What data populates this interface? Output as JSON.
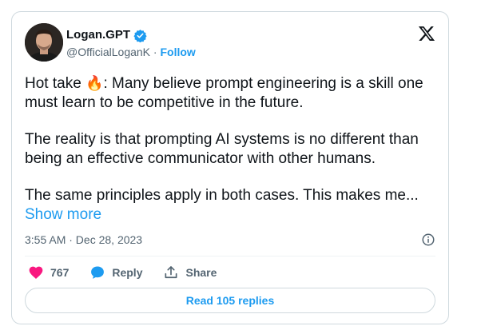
{
  "author": {
    "name": "Logan.GPT",
    "handle": "@OfficialLoganK",
    "separator": "·",
    "follow_label": "Follow"
  },
  "tweet": {
    "p1_pre": "Hot take ",
    "p1_emoji": "🔥",
    "p1_post": ": Many believe prompt engineering is a skill one must learn to be competitive in the future.",
    "p2": "The reality is that prompting AI systems is no different than being an effective communicator with other humans.",
    "p3": "The same principles apply in both cases. This makes me... ",
    "show_more": "Show more"
  },
  "meta": {
    "time": "3:55 AM · Dec 28, 2023"
  },
  "actions": {
    "likes": "767",
    "reply_label": "Reply",
    "share_label": "Share"
  },
  "read_replies_label": "Read 105 replies",
  "icons": {
    "verified": "verified-badge-icon",
    "x_logo": "x-logo-icon",
    "info": "info-icon",
    "heart": "heart-icon",
    "reply": "reply-bubble-icon",
    "share": "share-upload-icon"
  },
  "colors": {
    "accent": "#1d9bf0",
    "like": "#f91880",
    "text": "#0f1419",
    "muted": "#536471",
    "border": "#cfd9de"
  }
}
